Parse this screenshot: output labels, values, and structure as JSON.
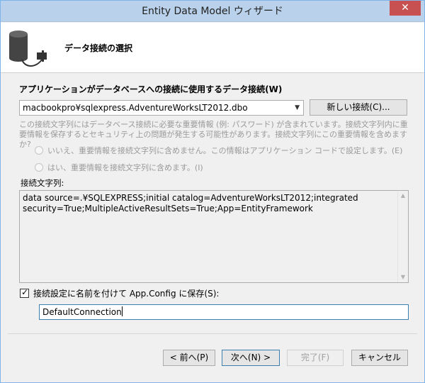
{
  "window": {
    "title": "Entity Data Model ウィザード",
    "close_label": "✕"
  },
  "header": {
    "title": "データ接続の選択",
    "icon": "database-plug-icon"
  },
  "connection": {
    "label": "アプリケーションがデータベースへの接続に使用するデータ接続(W)",
    "selected": "macbookpro¥sqlexpress.AdventureWorksLT2012.dbo",
    "new_button": "新しい接続(C)..."
  },
  "sensitive": {
    "warning": "この接続文字列にはデータベース接続に必要な重要情報 (例: パスワード) が含まれています。接続文字列内に重要情報を保存するとセキュリティ上の問題が発生する可能性があります。接続文字列にこの重要情報を含めますか?",
    "option_no": "いいえ、重要情報を接続文字列に含めません。この情報はアプリケーション コードで設定します。(E)",
    "option_yes": "はい、重要情報を接続文字列に含めます。(I)"
  },
  "connection_string": {
    "label": "接続文字列:",
    "value": "data source=.¥SQLEXPRESS;initial catalog=AdventureWorksLT2012;integrated security=True;MultipleActiveResultSets=True;App=EntityFramework"
  },
  "save": {
    "checkbox_label": "接続設定に名前を付けて App.Config に保存(S):",
    "checked": true,
    "name_value": "DefaultConnection"
  },
  "buttons": {
    "back": "< 前へ(P)",
    "next": "次へ(N) >",
    "finish": "完了(F)",
    "cancel": "キャンセル"
  },
  "colors": {
    "titlebar": "#b9d1ea",
    "close": "#c75050",
    "focus": "#3c7fb1"
  }
}
